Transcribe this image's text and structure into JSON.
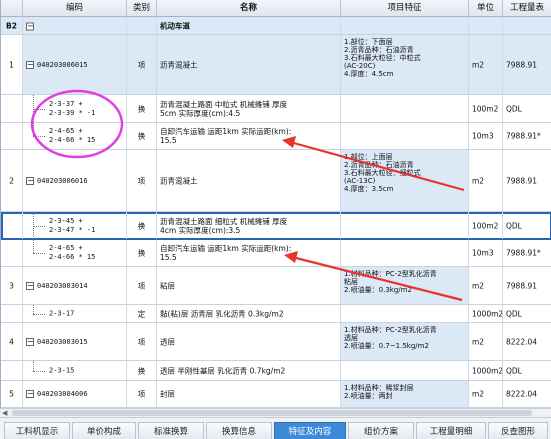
{
  "header": {
    "code": "编码",
    "type": "类别",
    "name": "名称",
    "feature": "项目特征",
    "unit": "单位",
    "qty": "工程量表"
  },
  "b2_row": {
    "num": "B2",
    "name": "机动车道"
  },
  "rows": [
    {
      "num": "1",
      "code": "040203006015",
      "type": "项",
      "name": "沥青混凝土",
      "feature": "1.部位：下面层\n2.沥青品种：石油沥青\n3.石料最大粒径：中粒式\n  (AC-20C)\n4.厚度：4.5cm",
      "unit": "m2",
      "qty": "7988.91"
    },
    {
      "num": "",
      "code": "2-3-37 +\n2-3-39 * -1",
      "type": "换",
      "name": "沥青混凝土路面 中粒式 机械摊铺 厚度\n5cm  实际厚度(cm):4.5",
      "feature": "",
      "unit": "100m2",
      "qty": "QDL"
    },
    {
      "num": "",
      "code": "2-4-65 +\n2-4-66 * 15",
      "type": "换",
      "name": "自卸汽车运输 运距1km  实际运距(km):\n15.5",
      "feature": "",
      "unit": "10m3",
      "qty": "7988.91*"
    },
    {
      "num": "2",
      "code": "040203006016",
      "type": "项",
      "name": "沥青混凝土",
      "feature": "1.部位：上面层\n2.沥青品种：石油沥青\n3.石料最大粒径：细粒式\n  (AC-13C)\n4.厚度：3.5cm",
      "unit": "m2",
      "qty": "7988.91"
    },
    {
      "num": "",
      "code": "2-3-45 +\n2-3-47 * -1",
      "type": "换",
      "name": "沥青混凝土路面 细粒式 机械摊铺 厚度\n4cm  实际厚度(cm):3.5",
      "feature": "",
      "unit": "100m2",
      "qty": "QDL"
    },
    {
      "num": "",
      "code": "2-4-65 +\n2-4-66 * 15",
      "type": "换",
      "name": "自卸汽车运输 运距1km  实际运距(km):\n15.5",
      "feature": "",
      "unit": "10m3",
      "qty": "7988.91*"
    },
    {
      "num": "3",
      "code": "040203003014",
      "type": "项",
      "name": "粘层",
      "feature": "1.材料品种：PC-2型乳化沥青\n粘层\n2.喷油量：0.3kg/m2",
      "unit": "m2",
      "qty": "7988.91"
    },
    {
      "num": "",
      "code": "2-3-17",
      "type": "定",
      "name": "黏(粘)层 沥青层 乳化沥青 0.3kg/m2",
      "feature": "",
      "unit": "1000m2",
      "qty": "QDL"
    },
    {
      "num": "4",
      "code": "040203003015",
      "type": "项",
      "name": "透层",
      "feature": "1.材料品种：PC-2型乳化沥青\n透层\n2.喷油量：0.7~1.5kg/m2",
      "unit": "m2",
      "qty": "8222.04"
    },
    {
      "num": "",
      "code": "2-3-15",
      "type": "换",
      "name": "透层 半刚性基层 乳化沥青 0.7kg/m2",
      "feature": "",
      "unit": "1000m2",
      "qty": "QDL"
    },
    {
      "num": "5",
      "code": "040203004006",
      "type": "项",
      "name": "封层",
      "feature": "1.材料品种：稀浆封层\n2.喷油量：两封",
      "unit": "m2",
      "qty": "8222.04"
    }
  ],
  "tabs": [
    "工料机显示",
    "单价构成",
    "标准换算",
    "换算信息",
    "特征及内容",
    "组价方案",
    "工程量明细",
    "反查图形"
  ],
  "active_tab": "特征及内容",
  "colors": {
    "annotation_circle": "#e040e0",
    "annotation_arrow": "#e8322a",
    "active_tab": "#3d8ad8",
    "main_row": "#dbe9f7"
  }
}
